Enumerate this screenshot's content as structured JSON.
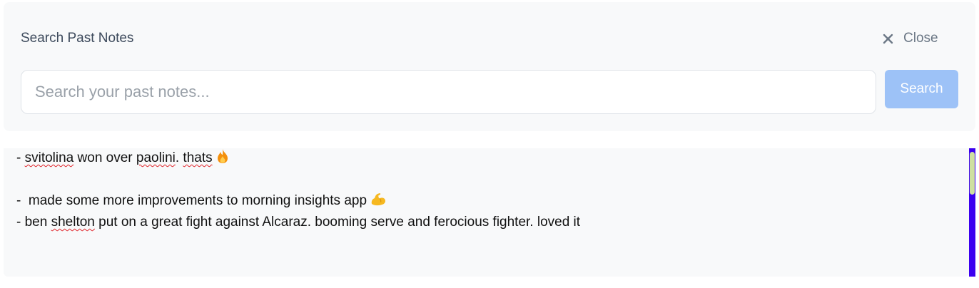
{
  "header": {
    "title": "Search Past Notes",
    "close_label": "Close"
  },
  "search": {
    "placeholder": "Search your past notes...",
    "value": "",
    "button_label": "Search"
  },
  "notes": {
    "line1": {
      "prefix": "- ",
      "w1": "svitolina",
      "m1": " won over ",
      "w2": "paolini",
      "m2": ". ",
      "w3": "thats",
      "emoji": "fire-icon"
    },
    "line2": {
      "text": "-  made some more improvements to morning insights app",
      "emoji": "flexed-biceps-icon"
    },
    "line3": {
      "prefix": "- ben ",
      "w1": "shelton",
      "rest": " put on a great fight against Alcaraz. booming serve and ferocious fighter. loved it"
    }
  },
  "colors": {
    "search_button": "#9dc2f7",
    "scrollbar_track": "#3b00f0",
    "scrollbar_thumb": "#cfe0a0",
    "spellcheck_underline": "#e0242a"
  }
}
